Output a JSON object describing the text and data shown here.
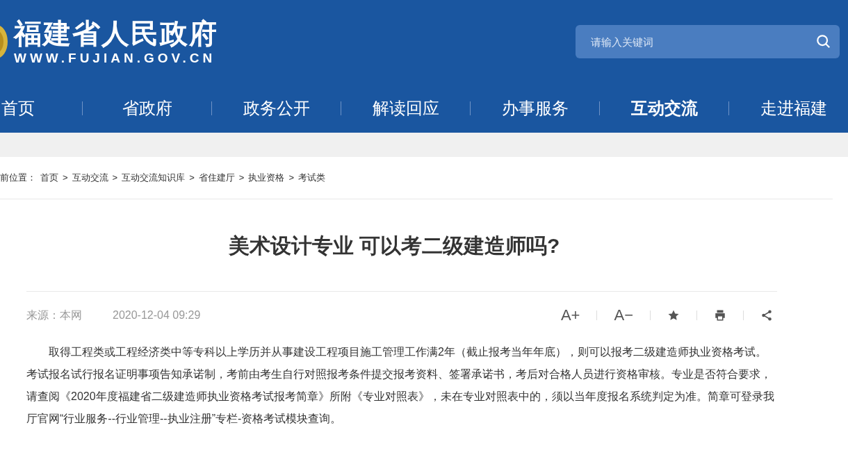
{
  "header": {
    "site_name": "福建省人民政府",
    "site_url": "WWW.FUJIAN.GOV.CN",
    "search": {
      "placeholder": "请输入关键词"
    }
  },
  "nav": [
    {
      "label": "首页",
      "selected": false
    },
    {
      "label": "省政府",
      "selected": false
    },
    {
      "label": "政务公开",
      "selected": false
    },
    {
      "label": "解读回应",
      "selected": false
    },
    {
      "label": "办事服务",
      "selected": false
    },
    {
      "label": "互动交流",
      "selected": true
    },
    {
      "label": "走进福建",
      "selected": false
    }
  ],
  "breadcrumb": {
    "prefix": "前位置：",
    "items": [
      "首页",
      "互动交流",
      "互动交流知识库",
      "省住建厅",
      "执业资格",
      "考试类"
    ],
    "separator": ">"
  },
  "article": {
    "title": "美术设计专业 可以考二级建造师吗?",
    "source": "来源：本网",
    "date": "2020-12-04 09:29",
    "tools": [
      {
        "kind": "text",
        "label": "A+"
      },
      {
        "kind": "text",
        "label": "A−"
      },
      {
        "kind": "star"
      },
      {
        "kind": "print"
      },
      {
        "kind": "share"
      }
    ],
    "body": "取得工程类或工程经济类中等专科以上学历并从事建设工程项目施工管理工作满2年（截止报考当年年底），则可以报考二级建造师执业资格考试。考试报名试行报名证明事项告知承诺制，考前由考生自行对照报考条件提交报考资料、签署承诺书，考后对合格人员进行资格审核。专业是否符合要求，请查阅《2020年度福建省二级建造师执业资格考试报考简章》所附《专业对照表》，未在专业对照表中的，须以当年度报名系统判定为准。简章可登录我厅官网“行业服务--行业管理--执业注册”专栏-资格考试模块查询。"
  }
}
